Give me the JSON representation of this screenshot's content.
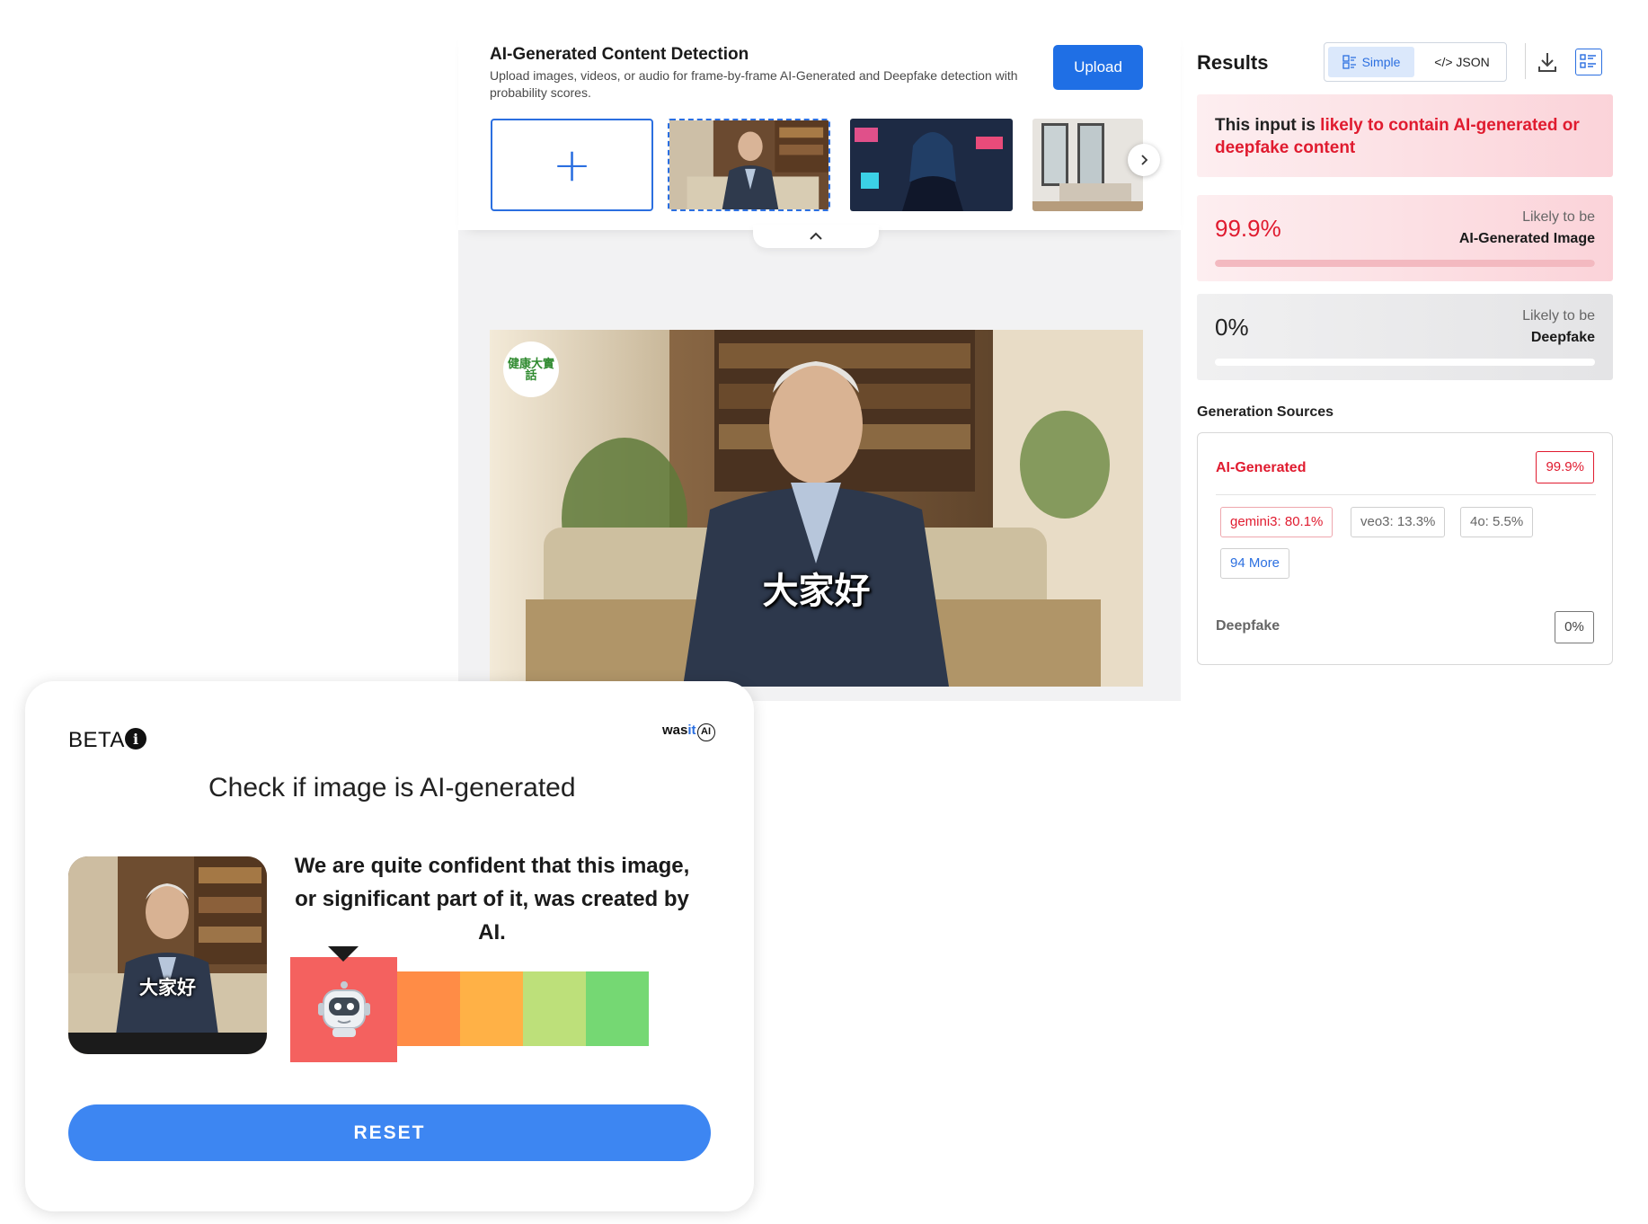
{
  "detection": {
    "title": "AI-Generated Content Detection",
    "description": "Upload images, videos, or audio for frame-by-frame AI-Generated and Deepfake detection with probability scores.",
    "upload_label": "Upload",
    "add_symbol": "+",
    "main_image": {
      "caption": "大家好",
      "logo": "健康大實話"
    }
  },
  "results": {
    "title": "Results",
    "view_simple": "Simple",
    "view_json": "</> JSON",
    "alert_prefix": "This input is ",
    "alert_highlight": "likely to contain AI-generated or deepfake content",
    "ai_score": {
      "value": "99.9%",
      "label_top": "Likely to be",
      "label_bottom": "AI-Generated Image",
      "fraction": 0.999
    },
    "deepfake_score": {
      "value": "0%",
      "label_top": "Likely to be",
      "label_bottom": "Deepfake",
      "fraction": 0
    },
    "generation_sources": {
      "title": "Generation Sources",
      "ai_label": "AI-Generated",
      "ai_value": "99.9%",
      "chips": [
        "gemini3: 80.1%",
        "veo3: 13.3%",
        "4o: 5.5%"
      ],
      "more": "94 More",
      "deepfake_label": "Deepfake",
      "deepfake_value": "0%"
    }
  },
  "wasit": {
    "beta": "BETA",
    "info": "i",
    "logo_was": "was",
    "logo_it": "it",
    "logo_ai": "AI",
    "heading": "Check if image is AI-generated",
    "message": "We are quite confident that this image, or significant part of it, was created by AI.",
    "thumb_caption": "大家好",
    "scale_colors": [
      "#f4615f",
      "#ff8c46",
      "#ffb146",
      "#bde07a",
      "#75d873"
    ],
    "reset_label": "RESET"
  }
}
